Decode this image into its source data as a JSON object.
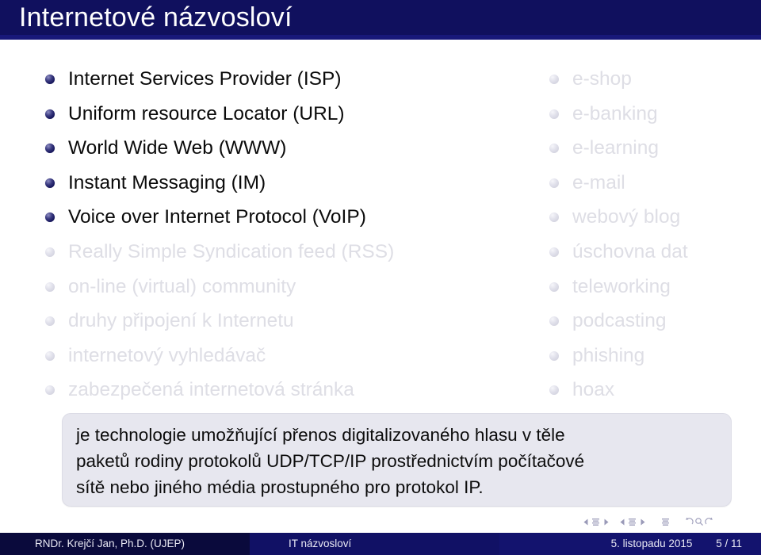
{
  "slide": {
    "title": "Internetové názvosloví",
    "title_bar_color": "#10105E",
    "active_text_color": "#0B0B0B",
    "faded_text_color": "#DEDEE5",
    "active_bullet_color": "#1A1A60",
    "faded_bullet_color": "#D8D8E4"
  },
  "left_column": {
    "items": [
      {
        "label": "Internet Services Provider (ISP)",
        "state": "active"
      },
      {
        "label": "Uniform resource Locator (URL)",
        "state": "active"
      },
      {
        "label": "World Wide Web (WWW)",
        "state": "active"
      },
      {
        "label": "Instant Messaging (IM)",
        "state": "active"
      },
      {
        "label": "Voice over Internet Protocol (VoIP)",
        "state": "active"
      },
      {
        "label": "Really Simple Syndication feed (RSS)",
        "state": "faded"
      },
      {
        "label": "on-line (virtual) community",
        "state": "faded"
      },
      {
        "label": "druhy připojení k Internetu",
        "state": "faded"
      },
      {
        "label": "internetový vyhledávač",
        "state": "faded"
      },
      {
        "label": "zabezpečená internetová stránka",
        "state": "faded"
      }
    ]
  },
  "right_column": {
    "items": [
      {
        "label": "e-shop",
        "state": "faded"
      },
      {
        "label": "e-banking",
        "state": "faded"
      },
      {
        "label": "e-learning",
        "state": "faded"
      },
      {
        "label": "e-mail",
        "state": "faded"
      },
      {
        "label": "webový blog",
        "state": "faded"
      },
      {
        "label": "úschovna dat",
        "state": "faded"
      },
      {
        "label": "teleworking",
        "state": "faded"
      },
      {
        "label": "podcasting",
        "state": "faded"
      },
      {
        "label": "phishing",
        "state": "faded"
      },
      {
        "label": "hoax",
        "state": "faded"
      }
    ]
  },
  "callout": {
    "lines": [
      "je technologie umožňující přenos digitalizovaného hlasu v těle",
      "paketů rodiny protokolů UDP/TCP/IP prostřednictvím počítačové",
      "sítě nebo jiného média prostupného pro protokol IP."
    ],
    "background_color": "#E7E7EF"
  },
  "nav_symbols": {
    "icons": [
      "prev-slide-icon",
      "slide-icon",
      "next-slide-icon",
      "prev-frame-icon",
      "frame-icon",
      "next-frame-icon",
      "subsection-icon",
      "back-icon",
      "search-icon",
      "forward-icon"
    ]
  },
  "footer": {
    "author": "RNDr. Krejčí Jan, Ph.D.  (UJEP)",
    "subject": "IT názvosloví",
    "date": "5. listopadu 2015",
    "page": "5 / 11"
  }
}
